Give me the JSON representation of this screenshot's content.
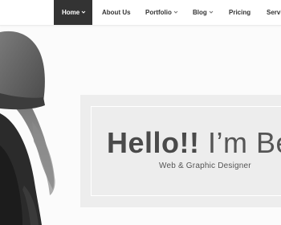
{
  "nav": {
    "items": [
      {
        "label": "Home",
        "has_dropdown": true,
        "active": true
      },
      {
        "label": "About Us",
        "has_dropdown": false,
        "active": false
      },
      {
        "label": "Portfolio",
        "has_dropdown": true,
        "active": false
      },
      {
        "label": "Blog",
        "has_dropdown": true,
        "active": false
      },
      {
        "label": "Pricing",
        "has_dropdown": false,
        "active": false
      },
      {
        "label": "Servi",
        "has_dropdown": false,
        "active": false
      }
    ]
  },
  "hero": {
    "title_bold": "Hello!!",
    "title_light": "I’m Be",
    "subtitle": "Web & Graphic Designer"
  },
  "colors": {
    "nav_active_bg": "#333333",
    "hero_frame": "#ededed",
    "page_bg": "#fbfbfb"
  }
}
